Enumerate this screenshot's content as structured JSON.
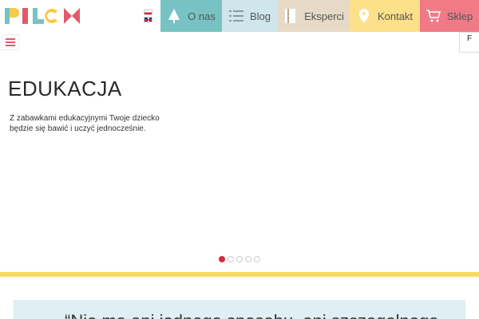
{
  "brand": {
    "logo_text": "PILCH"
  },
  "languages": [
    {
      "code": "pl",
      "icon": "poland-flag-icon"
    },
    {
      "code": "en",
      "icon": "uk-flag-icon"
    }
  ],
  "nav": {
    "items": [
      {
        "label": "O nas",
        "icon": "tree-icon",
        "color": "#77c3c4"
      },
      {
        "label": "Blog",
        "icon": "list-icon",
        "color": "#cfe7ec"
      },
      {
        "label": "Eksperci",
        "icon": "book-icon",
        "color": "#e6dac7"
      },
      {
        "label": "Kontakt",
        "icon": "location-pin-icon",
        "color": "#fce08a"
      },
      {
        "label": "Sklep",
        "icon": "cart-icon",
        "color": "#f17a87"
      }
    ]
  },
  "side_tab": {
    "label": "F"
  },
  "hero": {
    "title": "EDUKACJA",
    "description": "Z zabawkami edukacyjnymi Twoje dziecko będzie się bawić i uczyć jednocześnie."
  },
  "slider": {
    "count": 5,
    "active": 1
  },
  "bottom": {
    "text": "“Nie ma ani jednego sposobu, ani szczegolnego"
  },
  "colors": {
    "accent_red": "#d42a3c",
    "yellow_bar": "#f7d865",
    "box_bg": "#dfeff3"
  }
}
